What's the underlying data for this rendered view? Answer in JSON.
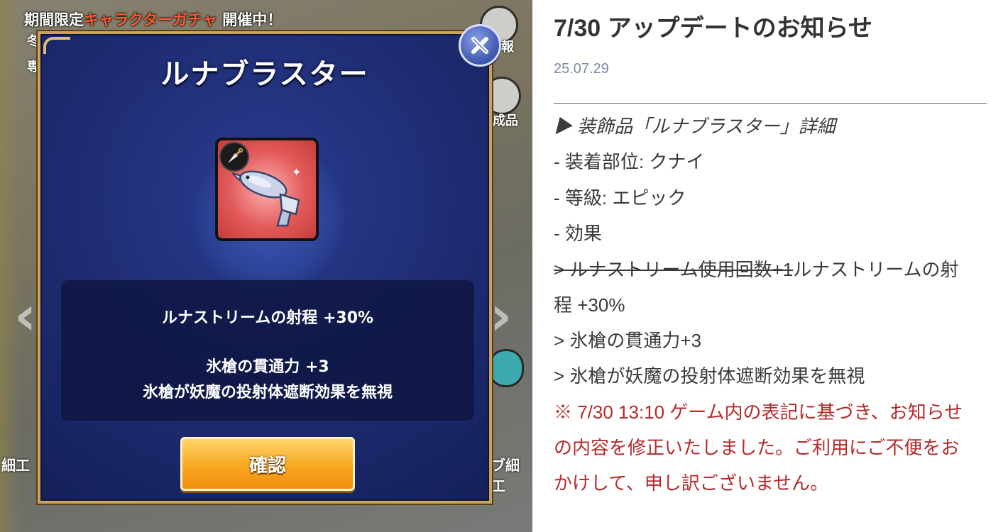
{
  "game": {
    "banner_prefix": "期間限定",
    "banner_highlight": "キャラクターガチャ",
    "banner_suffix": " 開催中！",
    "side_left_1": "冬",
    "side_left_2": "専",
    "side_right_1": "報",
    "side_right_2": "成品",
    "bottom_left": "細工",
    "bottom_right": "ブ細工"
  },
  "modal": {
    "title": "ルナブラスター",
    "desc_line1": "ルナストリームの射程 +30%",
    "desc_line2": "氷槍の貫通力 +3",
    "desc_line3": "氷槍が妖魔の投射体遮断効果を無視",
    "confirm_label": "確認",
    "item_icon": "water-gun-dolphin-icon",
    "badge_icon": "kunai-icon"
  },
  "article": {
    "title": "7/30 アップデートのお知らせ",
    "date": "25.07.29",
    "heading": "▶ 装飾品「ルナブラスター」詳細",
    "slot": "- 装着部位: クナイ",
    "grade": "- 等級: エピック",
    "effect_label": "- 効果",
    "struck_text": "> ルナストリーム使用回数+1",
    "effect_1a": "ルナストリームの射",
    "effect_1b": "程 +30%",
    "effect_2": "> 氷槍の貫通力+3",
    "effect_3": "> 氷槍が妖魔の投射体遮断効果を無視",
    "note_1": "※ 7/30 13:10 ゲーム内の表記に基づき、お知らせ",
    "note_2": "の内容を修正いたしました。ご利用にご不便をお",
    "note_3": "かけして、申し訳ございません。"
  },
  "colors": {
    "modal_bg": "#1d2b70",
    "modal_border": "#c9a35c",
    "confirm_button": "#f7a41c",
    "note_red": "#b52a2a",
    "date_gray": "#7c8aa0"
  }
}
